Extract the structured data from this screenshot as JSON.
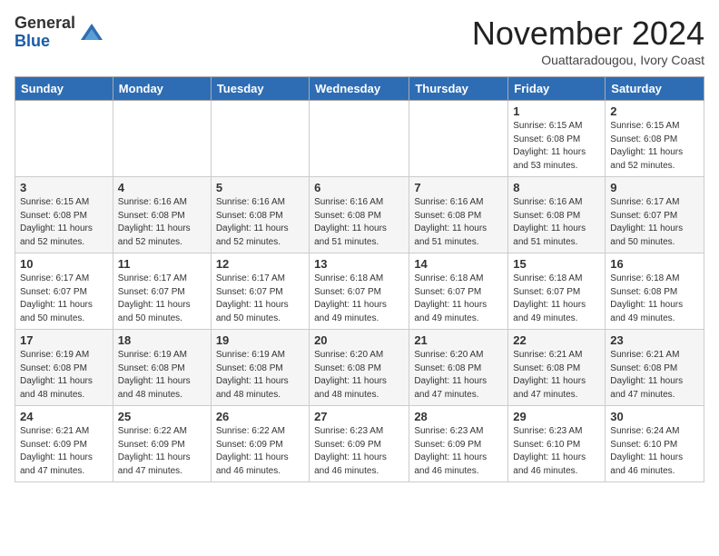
{
  "logo": {
    "general": "General",
    "blue": "Blue"
  },
  "header": {
    "month": "November 2024",
    "location": "Ouattaradougou, Ivory Coast"
  },
  "weekdays": [
    "Sunday",
    "Monday",
    "Tuesday",
    "Wednesday",
    "Thursday",
    "Friday",
    "Saturday"
  ],
  "weeks": [
    [
      {
        "day": "",
        "info": ""
      },
      {
        "day": "",
        "info": ""
      },
      {
        "day": "",
        "info": ""
      },
      {
        "day": "",
        "info": ""
      },
      {
        "day": "",
        "info": ""
      },
      {
        "day": "1",
        "info": "Sunrise: 6:15 AM\nSunset: 6:08 PM\nDaylight: 11 hours\nand 53 minutes."
      },
      {
        "day": "2",
        "info": "Sunrise: 6:15 AM\nSunset: 6:08 PM\nDaylight: 11 hours\nand 52 minutes."
      }
    ],
    [
      {
        "day": "3",
        "info": "Sunrise: 6:15 AM\nSunset: 6:08 PM\nDaylight: 11 hours\nand 52 minutes."
      },
      {
        "day": "4",
        "info": "Sunrise: 6:16 AM\nSunset: 6:08 PM\nDaylight: 11 hours\nand 52 minutes."
      },
      {
        "day": "5",
        "info": "Sunrise: 6:16 AM\nSunset: 6:08 PM\nDaylight: 11 hours\nand 52 minutes."
      },
      {
        "day": "6",
        "info": "Sunrise: 6:16 AM\nSunset: 6:08 PM\nDaylight: 11 hours\nand 51 minutes."
      },
      {
        "day": "7",
        "info": "Sunrise: 6:16 AM\nSunset: 6:08 PM\nDaylight: 11 hours\nand 51 minutes."
      },
      {
        "day": "8",
        "info": "Sunrise: 6:16 AM\nSunset: 6:08 PM\nDaylight: 11 hours\nand 51 minutes."
      },
      {
        "day": "9",
        "info": "Sunrise: 6:17 AM\nSunset: 6:07 PM\nDaylight: 11 hours\nand 50 minutes."
      }
    ],
    [
      {
        "day": "10",
        "info": "Sunrise: 6:17 AM\nSunset: 6:07 PM\nDaylight: 11 hours\nand 50 minutes."
      },
      {
        "day": "11",
        "info": "Sunrise: 6:17 AM\nSunset: 6:07 PM\nDaylight: 11 hours\nand 50 minutes."
      },
      {
        "day": "12",
        "info": "Sunrise: 6:17 AM\nSunset: 6:07 PM\nDaylight: 11 hours\nand 50 minutes."
      },
      {
        "day": "13",
        "info": "Sunrise: 6:18 AM\nSunset: 6:07 PM\nDaylight: 11 hours\nand 49 minutes."
      },
      {
        "day": "14",
        "info": "Sunrise: 6:18 AM\nSunset: 6:07 PM\nDaylight: 11 hours\nand 49 minutes."
      },
      {
        "day": "15",
        "info": "Sunrise: 6:18 AM\nSunset: 6:07 PM\nDaylight: 11 hours\nand 49 minutes."
      },
      {
        "day": "16",
        "info": "Sunrise: 6:18 AM\nSunset: 6:08 PM\nDaylight: 11 hours\nand 49 minutes."
      }
    ],
    [
      {
        "day": "17",
        "info": "Sunrise: 6:19 AM\nSunset: 6:08 PM\nDaylight: 11 hours\nand 48 minutes."
      },
      {
        "day": "18",
        "info": "Sunrise: 6:19 AM\nSunset: 6:08 PM\nDaylight: 11 hours\nand 48 minutes."
      },
      {
        "day": "19",
        "info": "Sunrise: 6:19 AM\nSunset: 6:08 PM\nDaylight: 11 hours\nand 48 minutes."
      },
      {
        "day": "20",
        "info": "Sunrise: 6:20 AM\nSunset: 6:08 PM\nDaylight: 11 hours\nand 48 minutes."
      },
      {
        "day": "21",
        "info": "Sunrise: 6:20 AM\nSunset: 6:08 PM\nDaylight: 11 hours\nand 47 minutes."
      },
      {
        "day": "22",
        "info": "Sunrise: 6:21 AM\nSunset: 6:08 PM\nDaylight: 11 hours\nand 47 minutes."
      },
      {
        "day": "23",
        "info": "Sunrise: 6:21 AM\nSunset: 6:08 PM\nDaylight: 11 hours\nand 47 minutes."
      }
    ],
    [
      {
        "day": "24",
        "info": "Sunrise: 6:21 AM\nSunset: 6:09 PM\nDaylight: 11 hours\nand 47 minutes."
      },
      {
        "day": "25",
        "info": "Sunrise: 6:22 AM\nSunset: 6:09 PM\nDaylight: 11 hours\nand 47 minutes."
      },
      {
        "day": "26",
        "info": "Sunrise: 6:22 AM\nSunset: 6:09 PM\nDaylight: 11 hours\nand 46 minutes."
      },
      {
        "day": "27",
        "info": "Sunrise: 6:23 AM\nSunset: 6:09 PM\nDaylight: 11 hours\nand 46 minutes."
      },
      {
        "day": "28",
        "info": "Sunrise: 6:23 AM\nSunset: 6:09 PM\nDaylight: 11 hours\nand 46 minutes."
      },
      {
        "day": "29",
        "info": "Sunrise: 6:23 AM\nSunset: 6:10 PM\nDaylight: 11 hours\nand 46 minutes."
      },
      {
        "day": "30",
        "info": "Sunrise: 6:24 AM\nSunset: 6:10 PM\nDaylight: 11 hours\nand 46 minutes."
      }
    ]
  ]
}
